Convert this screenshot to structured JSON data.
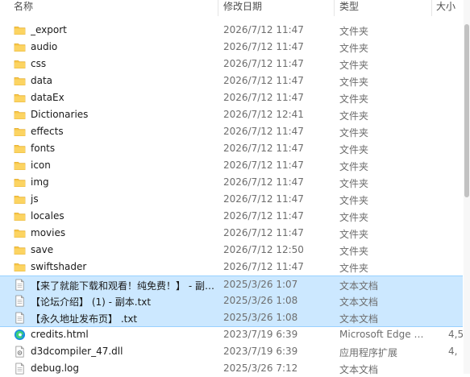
{
  "columns": {
    "name": "名称",
    "date": "修改日期",
    "type": "类型",
    "size": "大小"
  },
  "files": [
    {
      "name": "_export",
      "date": "2026/7/12 11:47",
      "type": "文件夹",
      "size": "",
      "icon": "folder-icon",
      "selected": false
    },
    {
      "name": "audio",
      "date": "2026/7/12 11:47",
      "type": "文件夹",
      "size": "",
      "icon": "folder-icon",
      "selected": false
    },
    {
      "name": "css",
      "date": "2026/7/12 11:47",
      "type": "文件夹",
      "size": "",
      "icon": "folder-icon",
      "selected": false
    },
    {
      "name": "data",
      "date": "2026/7/12 11:47",
      "type": "文件夹",
      "size": "",
      "icon": "folder-icon",
      "selected": false
    },
    {
      "name": "dataEx",
      "date": "2026/7/12 11:47",
      "type": "文件夹",
      "size": "",
      "icon": "folder-icon",
      "selected": false
    },
    {
      "name": "Dictionaries",
      "date": "2026/7/12 12:41",
      "type": "文件夹",
      "size": "",
      "icon": "folder-icon",
      "selected": false
    },
    {
      "name": "effects",
      "date": "2026/7/12 11:47",
      "type": "文件夹",
      "size": "",
      "icon": "folder-icon",
      "selected": false
    },
    {
      "name": "fonts",
      "date": "2026/7/12 11:47",
      "type": "文件夹",
      "size": "",
      "icon": "folder-icon",
      "selected": false
    },
    {
      "name": "icon",
      "date": "2026/7/12 11:47",
      "type": "文件夹",
      "size": "",
      "icon": "folder-icon",
      "selected": false
    },
    {
      "name": "img",
      "date": "2026/7/12 11:47",
      "type": "文件夹",
      "size": "",
      "icon": "folder-icon",
      "selected": false
    },
    {
      "name": "js",
      "date": "2026/7/12 11:47",
      "type": "文件夹",
      "size": "",
      "icon": "folder-icon",
      "selected": false
    },
    {
      "name": "locales",
      "date": "2026/7/12 11:47",
      "type": "文件夹",
      "size": "",
      "icon": "folder-icon",
      "selected": false
    },
    {
      "name": "movies",
      "date": "2026/7/12 11:47",
      "type": "文件夹",
      "size": "",
      "icon": "folder-icon",
      "selected": false
    },
    {
      "name": "save",
      "date": "2026/7/12 12:50",
      "type": "文件夹",
      "size": "",
      "icon": "folder-icon",
      "selected": false
    },
    {
      "name": "swiftshader",
      "date": "2026/7/12 11:47",
      "type": "文件夹",
      "size": "",
      "icon": "folder-icon",
      "selected": false
    },
    {
      "name": "【来了就能下载和观看！纯免费！】 - 副…",
      "date": "2025/3/26 1:07",
      "type": "文本文档",
      "size": "",
      "icon": "text-file-icon",
      "selected": true
    },
    {
      "name": "【论坛介绍】 (1) - 副本.txt",
      "date": "2025/3/26 1:08",
      "type": "文本文档",
      "size": "",
      "icon": "text-file-icon",
      "selected": true
    },
    {
      "name": "【永久地址发布页】 .txt",
      "date": "2025/3/26 1:08",
      "type": "文本文档",
      "size": "",
      "icon": "text-file-icon",
      "selected": true
    },
    {
      "name": "credits.html",
      "date": "2023/7/19 6:39",
      "type": "Microsoft Edge …",
      "size": "4,5",
      "icon": "edge-icon",
      "selected": false
    },
    {
      "name": "d3dcompiler_47.dll",
      "date": "2023/7/19 6:39",
      "type": "应用程序扩展",
      "size": "4,",
      "icon": "dll-file-icon",
      "selected": false
    },
    {
      "name": "debug.log",
      "date": "2025/3/26 7:12",
      "type": "文本文档",
      "size": "",
      "icon": "text-file-icon",
      "selected": false
    }
  ],
  "colors": {
    "folder": "#f8c84a",
    "selection": "#cce8ff",
    "selection_border": "#99d1ff"
  }
}
